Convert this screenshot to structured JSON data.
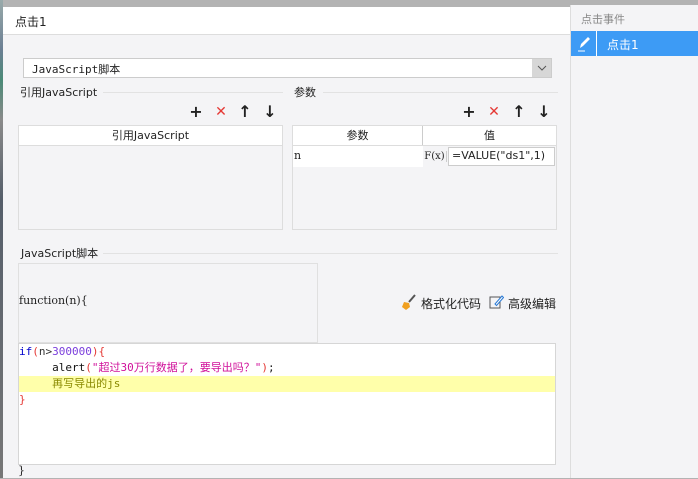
{
  "dialog": {
    "title": "点击1"
  },
  "type_select": {
    "value": "JavaScript脚本"
  },
  "ref_js": {
    "section": "引用JavaScript",
    "column": "引用JavaScript",
    "toolbar": {
      "add": "+",
      "delete": "✕",
      "up": "🡑",
      "down": "🡓"
    }
  },
  "params": {
    "section": "参数",
    "columns": [
      "参数",
      "值"
    ],
    "rows": [
      {
        "name": "n",
        "formula_icon": "F(x)",
        "value": "=VALUE(\"ds1\",1)"
      }
    ]
  },
  "script": {
    "section": "JavaScript脚本",
    "signature": "function(n){",
    "format_button": "格式化代码",
    "advanced_button": "高级编辑",
    "lines": {
      "l1_kw": "if",
      "l1_p1": "(",
      "l1_n": "n>",
      "l1_num": "300000",
      "l1_p2": "){",
      "l2_indent": "     ",
      "l2_fn": "alert",
      "l2_p1": "(",
      "l2_str": "\"超过30万行数据了，要导出吗？\"",
      "l2_p2": ")",
      "l2_end": ";",
      "l3": "     再写导出的js",
      "l4": "}"
    },
    "closing": "}"
  },
  "events_panel": {
    "title": "点击事件",
    "items": [
      {
        "label": "点击1",
        "selected": true
      }
    ]
  },
  "colors": {
    "accent": "#3d9bf5",
    "delete": "#e53935",
    "highlight": "#ffffaa"
  }
}
